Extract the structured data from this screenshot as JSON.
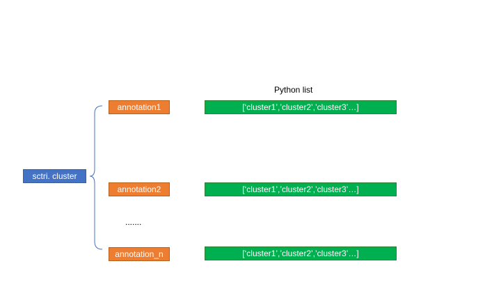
{
  "root": {
    "label": "sctri. cluster",
    "color": "#4472c4"
  },
  "header": {
    "list_label": "Python list"
  },
  "annotations": [
    {
      "label": "annotation1",
      "list": "[‘cluster1’,’cluster2’,’cluster3’…]"
    },
    {
      "label": "annotation2",
      "list": "[‘cluster1’,’cluster2’,’cluster3’…]"
    },
    {
      "label": "annotation_n",
      "list": "[‘cluster1’,’cluster2’,’cluster3’…]"
    }
  ],
  "ellipsis": ".......",
  "colors": {
    "annotation": "#ed7d31",
    "list": "#00b050",
    "bracket": "#4472c4"
  }
}
